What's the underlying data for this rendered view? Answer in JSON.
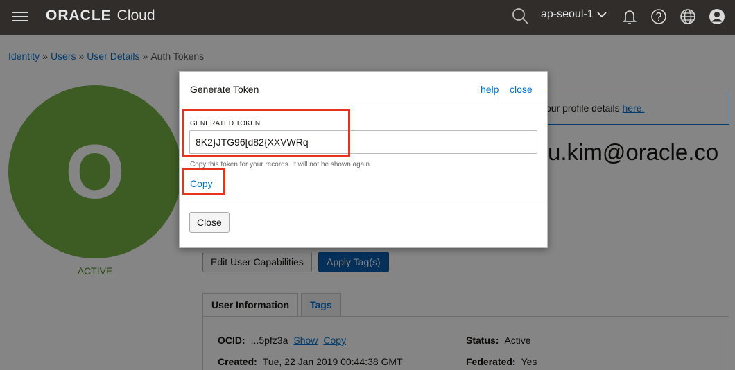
{
  "nav": {
    "brand": "ORACLE",
    "product": "Cloud",
    "region": "ap-seoul-1"
  },
  "breadcrumb": {
    "items": [
      "Identity",
      "Users",
      "User Details"
    ],
    "current": "Auth Tokens",
    "separator": "»"
  },
  "user": {
    "avatar_letter": "O",
    "status_label": "ACTIVE",
    "email_partial": "u.kim@oracle.co"
  },
  "banner": {
    "text": "our profile details ",
    "link": "here."
  },
  "actions": {
    "edit_capabilities": "Edit User Capabilities",
    "apply_tags": "Apply Tag(s)"
  },
  "tabs": {
    "user_information": "User Information",
    "tags": "Tags"
  },
  "details": {
    "ocid_label": "OCID:",
    "ocid_value": "...5pfz3a",
    "ocid_show": "Show",
    "ocid_copy": "Copy",
    "created_label": "Created:",
    "created_value": "Tue, 22 Jan 2019 00:44:38 GMT",
    "status_label": "Status:",
    "status_value": "Active",
    "federated_label": "Federated:",
    "federated_value": "Yes"
  },
  "modal": {
    "title": "Generate Token",
    "help": "help",
    "close_link": "close",
    "field_label": "GENERATED TOKEN",
    "token_value": "8K2}JTG96[d82{XXVWRq",
    "help_text": "Copy this token for your records. It will not be shown again.",
    "copy": "Copy",
    "close_button": "Close"
  },
  "colors": {
    "nav_bg": "#312d2a",
    "avatar_green": "#76b043",
    "link_blue": "#0572ce",
    "highlight_red": "#e8331c",
    "primary_button": "#0b5dad"
  },
  "icons": [
    "menu-icon",
    "search-icon",
    "chevron-down-icon",
    "bell-icon",
    "help-icon",
    "globe-icon",
    "user-profile-icon"
  ]
}
